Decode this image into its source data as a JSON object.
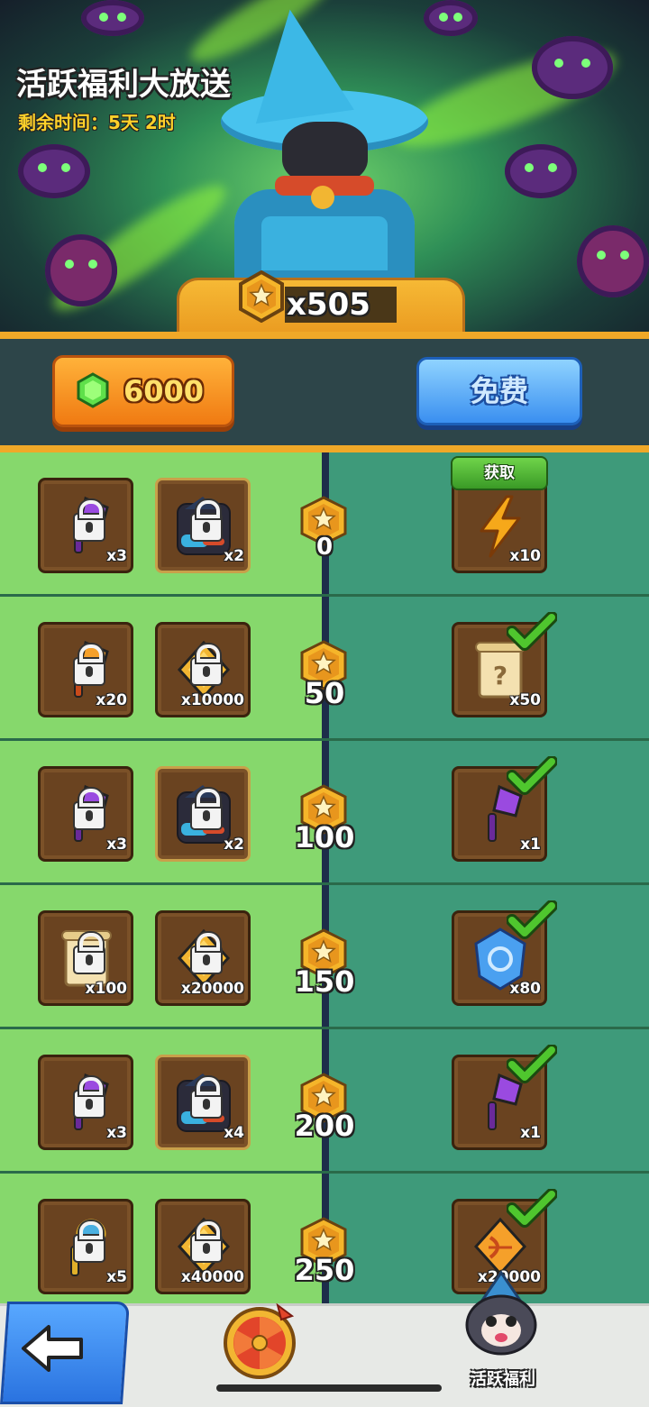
{
  "event": {
    "title": "活跃福利大放送",
    "timer": "剩余时间：5天 2时",
    "points": "x505"
  },
  "actions": {
    "gem_amount": "6000",
    "free_label": "免费"
  },
  "claim_badge": "获取",
  "tiers": [
    {
      "threshold": "0",
      "locked": [
        {
          "icon": "purple-key-icon",
          "qty": "x3"
        },
        {
          "icon": "wizard-cat-puzzle-icon",
          "qty": "x2"
        }
      ],
      "free": {
        "icon": "lightning-icon",
        "qty": "x10",
        "claimed": false
      }
    },
    {
      "threshold": "50",
      "locked": [
        {
          "icon": "orange-key-icon",
          "qty": "x20"
        },
        {
          "icon": "gold-coin-icon",
          "qty": "x10000"
        }
      ],
      "free": {
        "icon": "mystery-scroll-icon",
        "qty": "x50",
        "claimed": true
      }
    },
    {
      "threshold": "100",
      "locked": [
        {
          "icon": "purple-key-icon",
          "qty": "x3"
        },
        {
          "icon": "wizard-cat-puzzle-icon",
          "qty": "x2"
        }
      ],
      "free": {
        "icon": "purple-key-icon",
        "qty": "x1",
        "claimed": true
      }
    },
    {
      "threshold": "150",
      "locked": [
        {
          "icon": "scroll-icon",
          "qty": "x100"
        },
        {
          "icon": "gold-coin-icon",
          "qty": "x20000"
        }
      ],
      "free": {
        "icon": "blue-crystal-icon",
        "qty": "x80",
        "claimed": true
      }
    },
    {
      "threshold": "200",
      "locked": [
        {
          "icon": "purple-key-icon",
          "qty": "x3"
        },
        {
          "icon": "wizard-cat-puzzle-icon",
          "qty": "x4"
        }
      ],
      "free": {
        "icon": "purple-key-icon",
        "qty": "x1",
        "claimed": true
      }
    },
    {
      "threshold": "250",
      "locked": [
        {
          "icon": "gold-key-icon",
          "qty": "x5"
        },
        {
          "icon": "gold-coin-icon",
          "qty": "x40000"
        }
      ],
      "free": {
        "icon": "bow-token-icon",
        "qty": "x20000",
        "claimed": true
      }
    }
  ],
  "nav": {
    "back_icon": "back-arrow-icon",
    "wheel_icon": "lucky-wheel-icon",
    "active_label": "活跃福利"
  },
  "colors": {
    "left_column": "#86d86c",
    "right_column": "#3e9a7a",
    "accent_orange": "#f0a828",
    "accent_blue": "#3a8ff0",
    "check_green": "#4fc62e"
  }
}
